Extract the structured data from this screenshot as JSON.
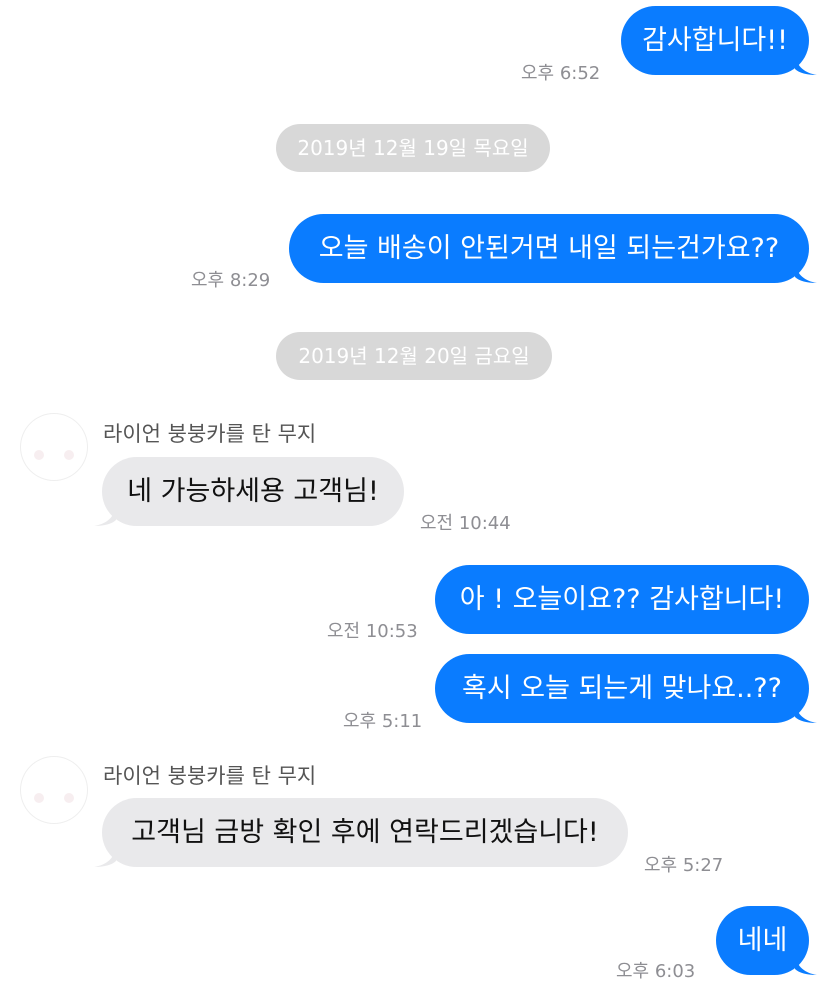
{
  "messages": [
    {
      "text": "감사합니다!!",
      "time": "오후 6:52"
    },
    {
      "text": "오늘 배송이 안된거면 내일 되는건가요??",
      "time": "오후 8:29"
    },
    {
      "text": "네 가능하세용 고객님!",
      "time": "오전 10:44"
    },
    {
      "text": "아 ! 오늘이요?? 감사합니다!",
      "time": "오전 10:53"
    },
    {
      "text": "혹시 오늘 되는게 맞나요..??",
      "time": "오후 5:11"
    },
    {
      "text": "고객님 금방 확인 후에 연락드리겠습니다!",
      "time": "오후 5:27"
    },
    {
      "text": "네네",
      "time": "오후 6:03"
    }
  ],
  "dates": [
    "2019년 12월 19일 목요일",
    "2019년 12월 20일 금요일"
  ],
  "sender": {
    "name": "라이언 붕붕카를 탄 무지"
  },
  "colors": {
    "outgoing_bubble": "#0a7cff",
    "incoming_bubble": "#e9e9eb",
    "date_pill": "#d8d8d8",
    "timestamp": "#8e8e93"
  }
}
